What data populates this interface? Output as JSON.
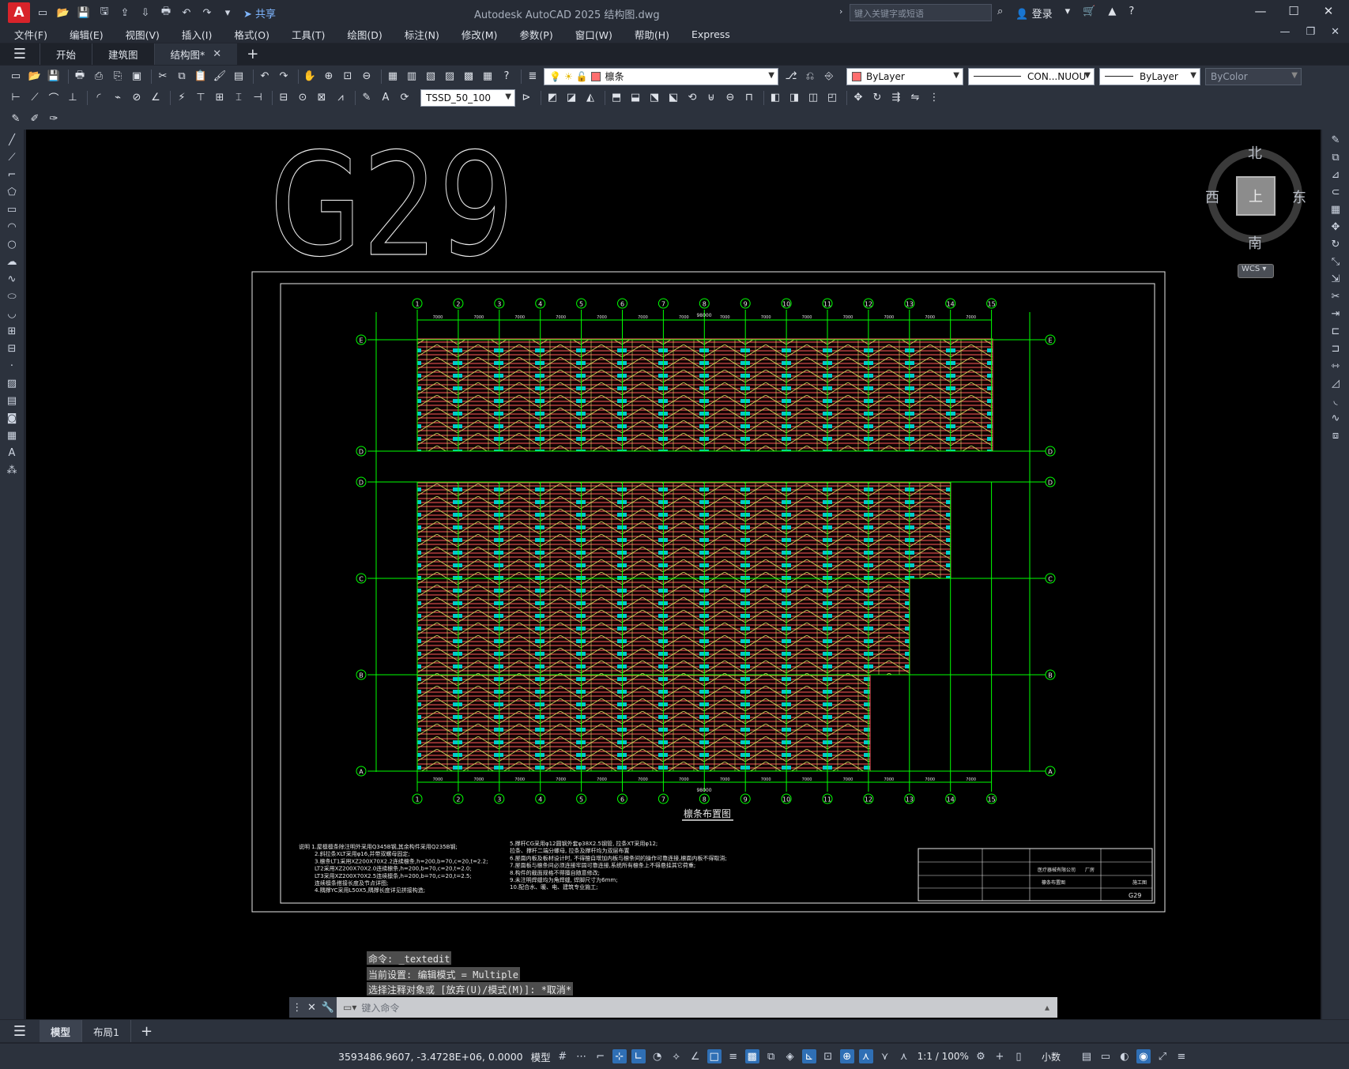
{
  "app": {
    "title": "Autodesk AutoCAD 2025    结构图.dwg",
    "logo": "A",
    "share": "共享",
    "search_placeholder": "键入关键字或短语",
    "login": "登录"
  },
  "menu": [
    "文件(F)",
    "编辑(E)",
    "视图(V)",
    "插入(I)",
    "格式(O)",
    "工具(T)",
    "绘图(D)",
    "标注(N)",
    "修改(M)",
    "参数(P)",
    "窗口(W)",
    "帮助(H)",
    "Express"
  ],
  "tabs": {
    "items": [
      {
        "label": "开始",
        "active": false,
        "closable": false
      },
      {
        "label": "建筑图",
        "active": false,
        "closable": false
      },
      {
        "label": "结构图*",
        "active": true,
        "closable": true
      }
    ],
    "add": "+"
  },
  "properties": {
    "layer": "檩条",
    "layer_color": "#ff6f6f",
    "color": "ByLayer",
    "linetype": "CON...NUOU",
    "lineweight": "ByLayer",
    "plotstyle": "ByColor",
    "dimstyle": "TSSD_50_100"
  },
  "viewcube": {
    "north": "北",
    "south": "南",
    "east": "东",
    "west": "西",
    "top": "上",
    "wcs": "WCS"
  },
  "drawing": {
    "sheet_label": "G29",
    "plan_title": "檩条布置图",
    "grid_cols": [
      "1",
      "2",
      "3",
      "4",
      "5",
      "6",
      "7",
      "8",
      "9",
      "10",
      "11",
      "12",
      "13",
      "14",
      "15"
    ],
    "grid_rows_upper": [
      "E",
      "D"
    ],
    "grid_rows_lower": [
      "D",
      "C",
      "B",
      "A"
    ],
    "dim_span": "7000",
    "dim_total": "98000",
    "notes_left": [
      "说明  1.屋檩檩条除注明外采用Q345B钢,其余构件采用Q235B钢;",
      "2.斜拉条XLT采用φ16,并带双螺母固定;",
      "3.檩条LT1采用XZ200X70X2.2连续檩条,h=200,b=70,c=20,t=2.2;",
      "LT2采用XZ200X70X2.0连续檩条,h=200,b=70,c=20,t=2.0;",
      "LT3采用XZ200X70X2.5连续檩条,h=200,b=70,c=20,t=2.5;",
      "连续檩条搭接长度及节点详图;",
      "4.隅撑YC采用L50X5,隅撑长度详见拼接构造;"
    ],
    "notes_right": [
      "5.撑杆CG采用φ12圆钢外套φ38X2.5钢管, 拉条XT采用φ12;",
      "拉条、撑杆二端分螺母, 拉条及撑杆均为双层布置",
      "6.屋面内板及板材设计时, 不得擅自增加内板与檩条间的操作可靠连接,檩面内板不得取消;",
      "7.屋面板与檩条间必须连接牢固可靠连接,系统所有檩条上不得悬挂其它荷重;",
      "8.构件的截面规格不得擅自随意修改;",
      "9.未注明焊缝均为角焊缝, 焊脚尺寸为6mm;",
      "10.配合水、暖、电、建筑专业施工;"
    ],
    "title_block": {
      "company": "医疗器械有限公司",
      "project": "厂房",
      "drawing_name": "檩条布置图",
      "number": "G29",
      "stage": "施工图"
    }
  },
  "command": {
    "history": [
      "命令: _textedit",
      "当前设置: 编辑模式 = Multiple",
      "选择注释对象或 [放弃(U)/模式(M)]: *取消*"
    ],
    "placeholder": "键入命令"
  },
  "layouts": [
    {
      "label": "模型",
      "active": true
    },
    {
      "label": "布局1",
      "active": false
    }
  ],
  "status": {
    "coords": "3593486.9607, -3.4728E+06, 0.0000",
    "space": "模型",
    "scale": "1:1 / 100%",
    "units": "小数"
  },
  "colors": {
    "grid_green": "#00ff00",
    "purlin_red": "#ff5a5a",
    "brace_yellow": "#d6e060",
    "tag_cyan": "#00cccc"
  }
}
